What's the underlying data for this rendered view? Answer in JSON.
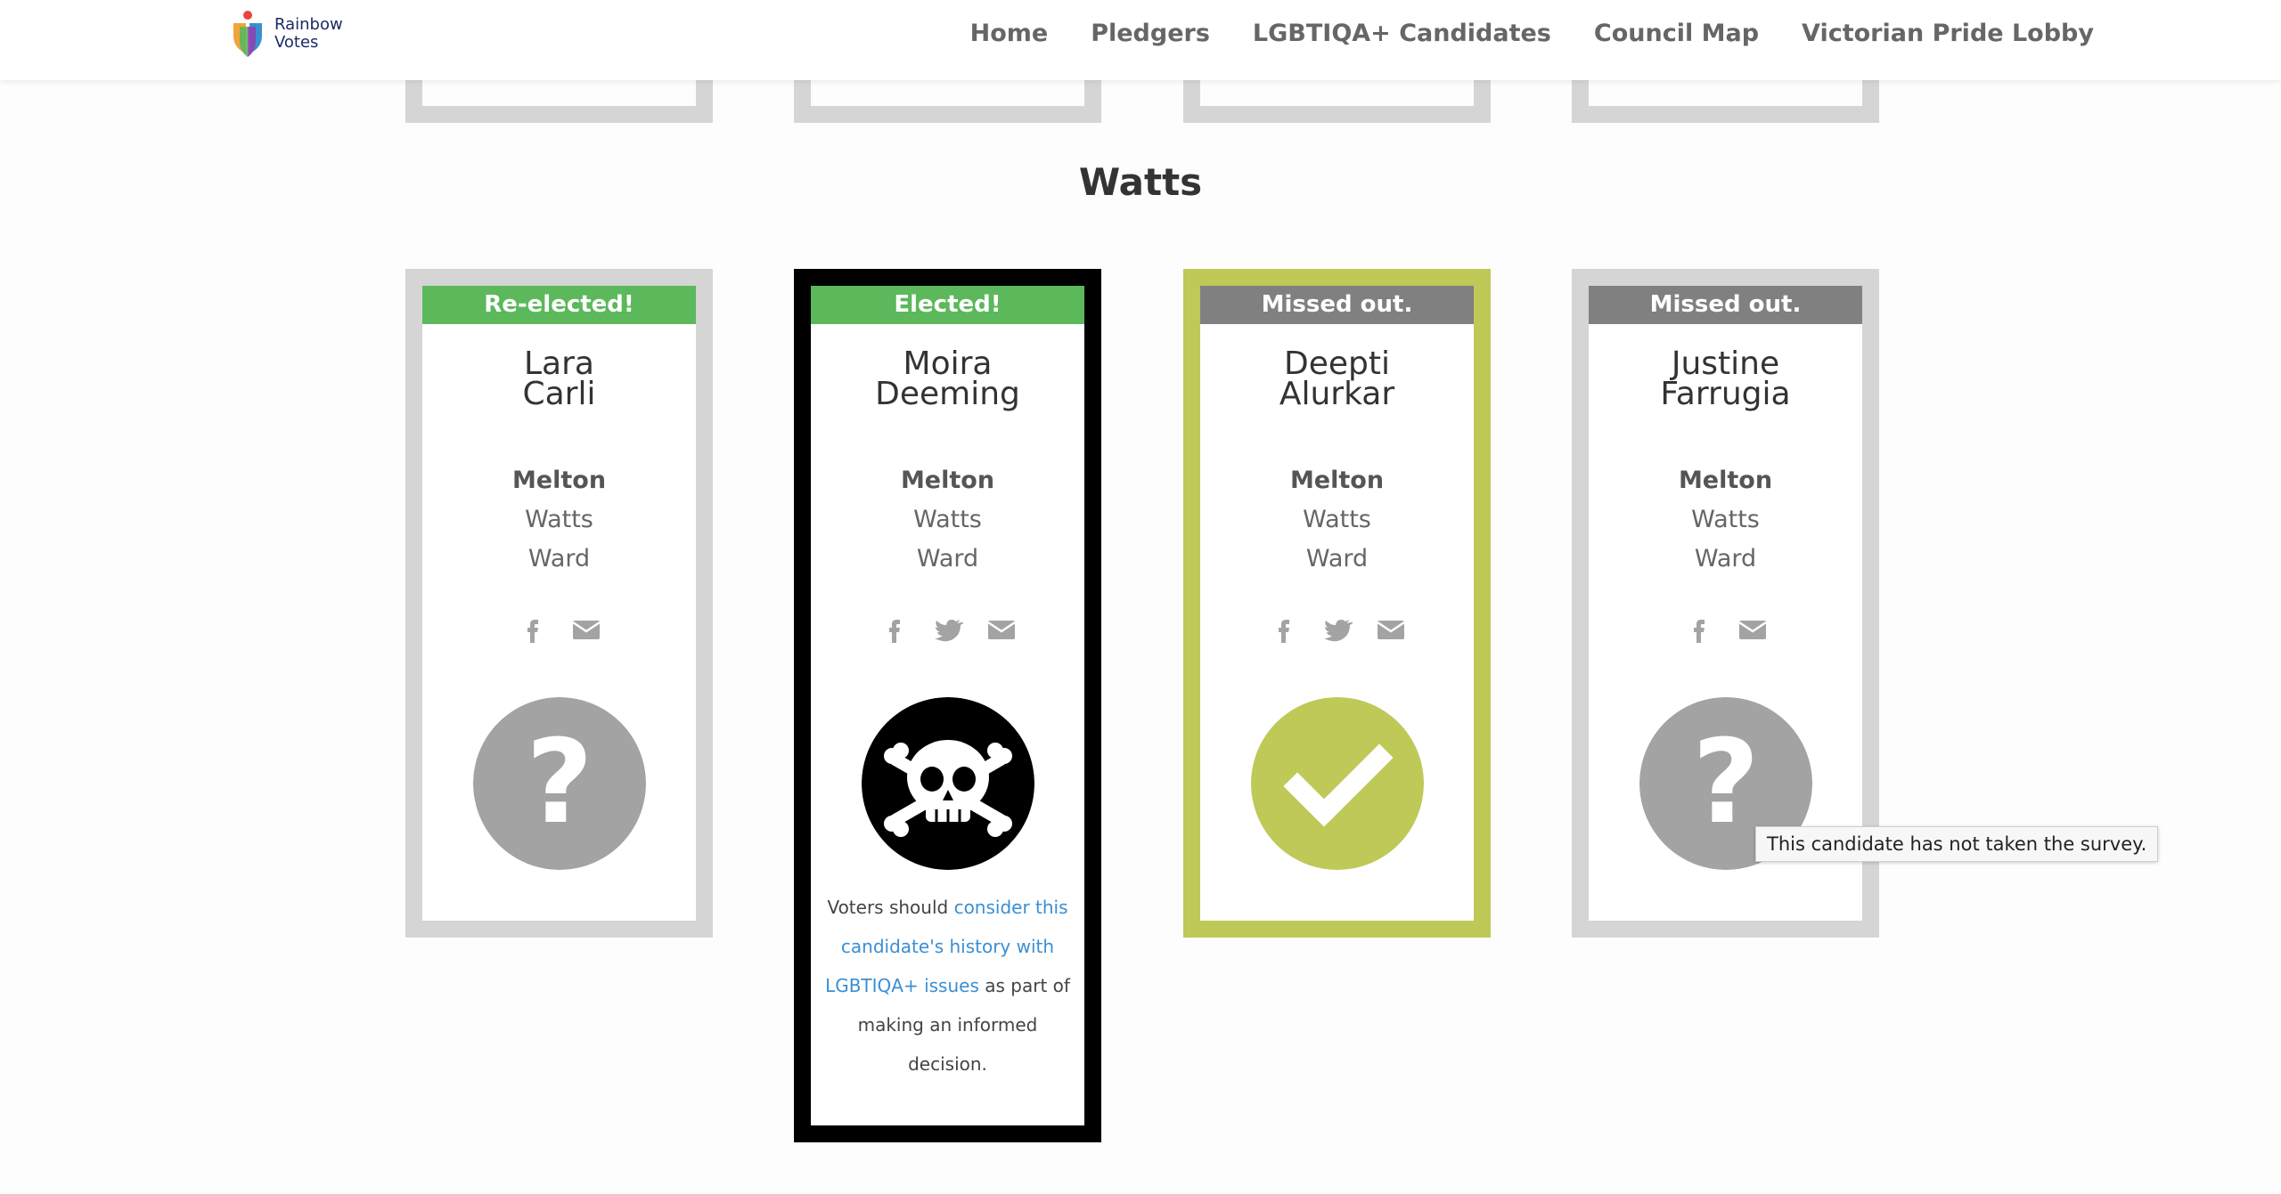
{
  "brand": {
    "line1": "Rainbow",
    "line2": "Votes"
  },
  "nav": [
    "Home",
    "Pledgers",
    "LGBTIQA+ Candidates",
    "Council Map",
    "Victorian Pride Lobby"
  ],
  "section_title": "Watts",
  "colors": {
    "frame_grey": "#d5d5d5",
    "frame_black": "#000000",
    "frame_green": "#bec957",
    "banner_elected": "#5bb85b",
    "banner_missed": "#808080",
    "badge_unknown": "#a3a3a3",
    "badge_pledged": "#bec957",
    "link": "#3a8fd3"
  },
  "cards": [
    {
      "status": "Re-elected!",
      "first_name": "Lara",
      "last_name": "Carli",
      "council": "Melton",
      "ward_name": "Watts",
      "ward_word": "Ward",
      "social": [
        "facebook-icon",
        "email-icon"
      ],
      "badge": "question-mark-icon"
    },
    {
      "status": "Elected!",
      "first_name": "Moira",
      "last_name": "Deeming",
      "council": "Melton",
      "ward_name": "Watts",
      "ward_word": "Ward",
      "social": [
        "facebook-icon",
        "twitter-icon",
        "email-icon"
      ],
      "badge": "skull-crossbones-icon",
      "note_before": "Voters should ",
      "note_link": "consider this candidate's history with LGBTIQA+ issues",
      "note_after": " as part of making an informed decision."
    },
    {
      "status": "Missed out.",
      "first_name": "Deepti",
      "last_name": "Alurkar",
      "council": "Melton",
      "ward_name": "Watts",
      "ward_word": "Ward",
      "social": [
        "facebook-icon",
        "twitter-icon",
        "email-icon"
      ],
      "badge": "checkmark-icon"
    },
    {
      "status": "Missed out.",
      "first_name": "Justine",
      "last_name": "Farrugia",
      "council": "Melton",
      "ward_name": "Watts",
      "ward_word": "Ward",
      "social": [
        "facebook-icon",
        "email-icon"
      ],
      "badge": "question-mark-icon"
    }
  ],
  "tooltip": "This candidate has not taken the survey."
}
